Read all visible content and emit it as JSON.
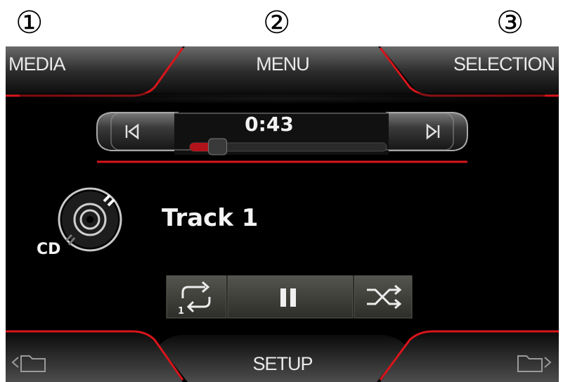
{
  "callouts": {
    "one": "①",
    "two": "②",
    "three": "③"
  },
  "top_bar": {
    "media": "MEDIA",
    "menu": "MENU",
    "selection": "SELECTION"
  },
  "player": {
    "elapsed": "0:43",
    "progress_fraction": 0.07,
    "track_name": "Track 1",
    "source": "CD"
  },
  "bottom_bar": {
    "setup": "SETUP"
  },
  "colors": {
    "accent_red": "#d8151b",
    "background": "#000000",
    "button_grey": "#3a3a35",
    "text": "#ececec"
  },
  "icons": [
    "previous-track-icon",
    "next-track-icon",
    "cd-icon",
    "repeat-one-icon",
    "pause-icon",
    "shuffle-icon",
    "folder-back-icon",
    "folder-forward-icon"
  ]
}
